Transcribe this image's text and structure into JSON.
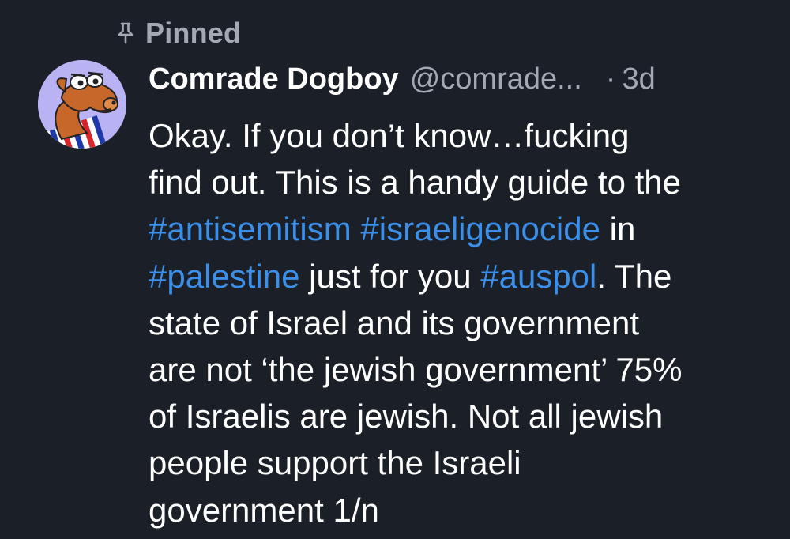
{
  "pinned": {
    "icon": "pin-icon",
    "label": "Pinned"
  },
  "post": {
    "author": {
      "display_name": "Comrade Dogboy",
      "handle": "@comrade...",
      "avatar": "cartoon-dog-avatar"
    },
    "separator": "·",
    "time": "3d",
    "body": {
      "line1": "Okay. If you don’t know…fucking",
      "line2": "find out. This is a handy guide to the",
      "line3_tag1": "#antisemitism",
      "line3_tag2": "#israeligenocide",
      "line3_text": " in",
      "line4_tag1": "#palestine",
      "line4_text1": " just for you ",
      "line4_tag2": "#auspol",
      "line4_text2": ". The",
      "line5": "state of Israel and its government",
      "line6": "are not ‘the jewish government’ 75%",
      "line7": "of Israelis are jewish. Not all jewish",
      "line8": "people support the Israeli",
      "line9": "government 1/n"
    }
  },
  "colors": {
    "background": "#1b2028",
    "text": "#ffffff",
    "muted": "#a3a9b3",
    "link": "#3b8fe8",
    "avatar_bg": "#b9b2f3"
  }
}
